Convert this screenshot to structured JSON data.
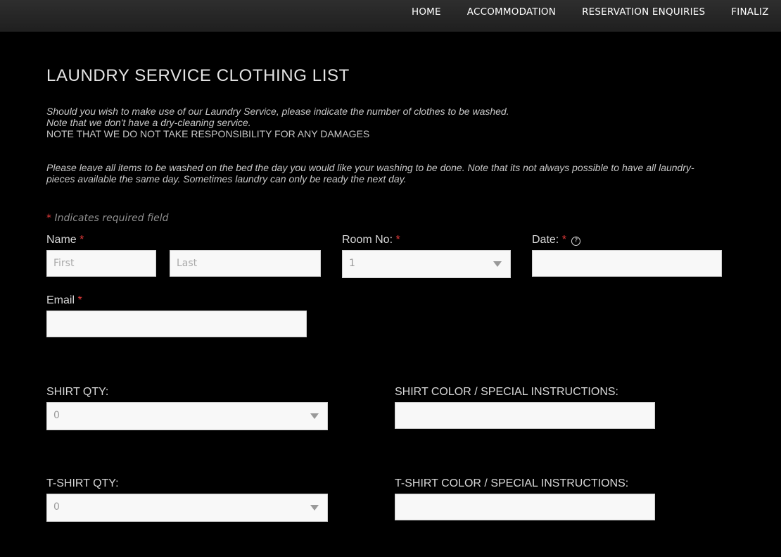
{
  "nav": {
    "items": [
      "HOME",
      "ACCOMMODATION",
      "RESERVATION ENQUIRIES",
      "FINALIZ"
    ]
  },
  "page": {
    "title": "LAUNDRY SERVICE CLOTHING LIST",
    "intro_line1": "Should you wish to make use of our Laundry Service, please indicate the number of clothes to be washed.",
    "intro_line2": "Note that we don't have a dry-cleaning service.",
    "intro_line3": "NOTE THAT WE DO NOT TAKE RESPONSIBILITY FOR ANY DAMAGES",
    "intro_para2": "Please leave all items to be washed on the bed the day you would like your washing to be done. Note that its not always possible to have all laundry-pieces available the same day. Sometimes laundry can only be ready the next day."
  },
  "form": {
    "required_star": "*",
    "required_note": "Indicates required field",
    "name_label": "Name",
    "first_placeholder": "First",
    "last_placeholder": "Last",
    "room_label": "Room No:",
    "room_value": "1",
    "date_label": "Date:",
    "date_help_icon": "help-circle-icon",
    "date_help_glyph": "?",
    "email_label": "Email",
    "shirt_qty_label": "SHIRT QTY:",
    "shirt_qty_value": "0",
    "shirt_color_label": "SHIRT COLOR / SPECIAL INSTRUCTIONS:",
    "tshirt_qty_label": "T-SHIRT QTY:",
    "tshirt_qty_value": "0",
    "tshirt_color_label": "T-SHIRT COLOR / SPECIAL INSTRUCTIONS:"
  },
  "colors": {
    "background": "#000000",
    "required_star": "#e23a3a",
    "field_bg": "#f8f8f8"
  }
}
